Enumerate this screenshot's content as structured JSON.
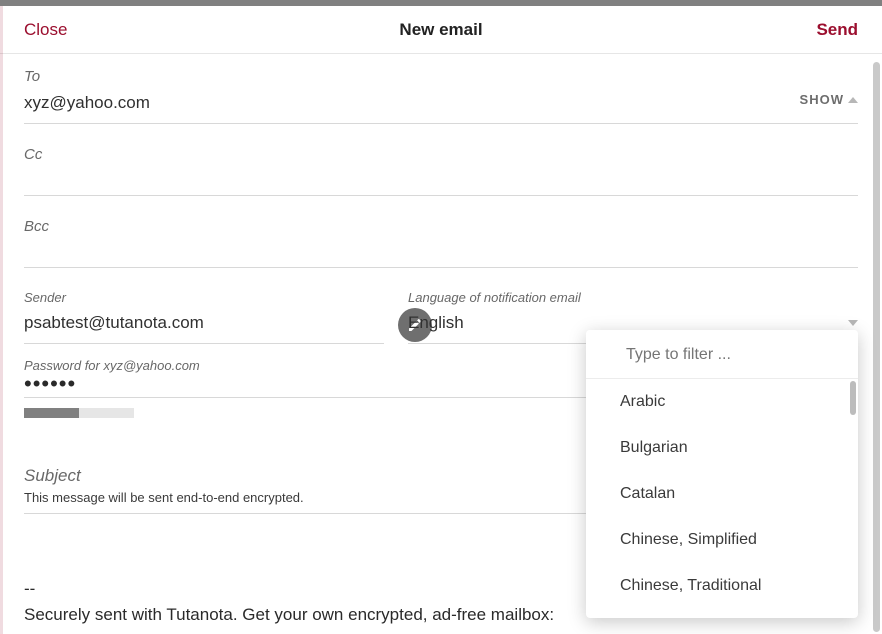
{
  "header": {
    "close": "Close",
    "title": "New email",
    "send": "Send"
  },
  "to": {
    "label": "To",
    "value": "xyz@yahoo.com",
    "show": "SHOW"
  },
  "cc": {
    "label": "Cc"
  },
  "bcc": {
    "label": "Bcc"
  },
  "sender": {
    "label": "Sender",
    "value": "psabtest@tutanota.com"
  },
  "lang": {
    "label": "Language of notification email",
    "value": "English"
  },
  "password": {
    "label": "Password for xyz@yahoo.com",
    "masked": "••••••"
  },
  "subject": {
    "label": "Subject",
    "note": "This message will be sent end-to-end encrypted."
  },
  "body": {
    "sep": "--",
    "sig": "Securely sent with Tutanota. Get your own encrypted, ad-free mailbox:"
  },
  "dropdown": {
    "filter_placeholder": "Type to filter ...",
    "options": [
      "Arabic",
      "Bulgarian",
      "Catalan",
      "Chinese, Simplified",
      "Chinese, Traditional"
    ]
  }
}
